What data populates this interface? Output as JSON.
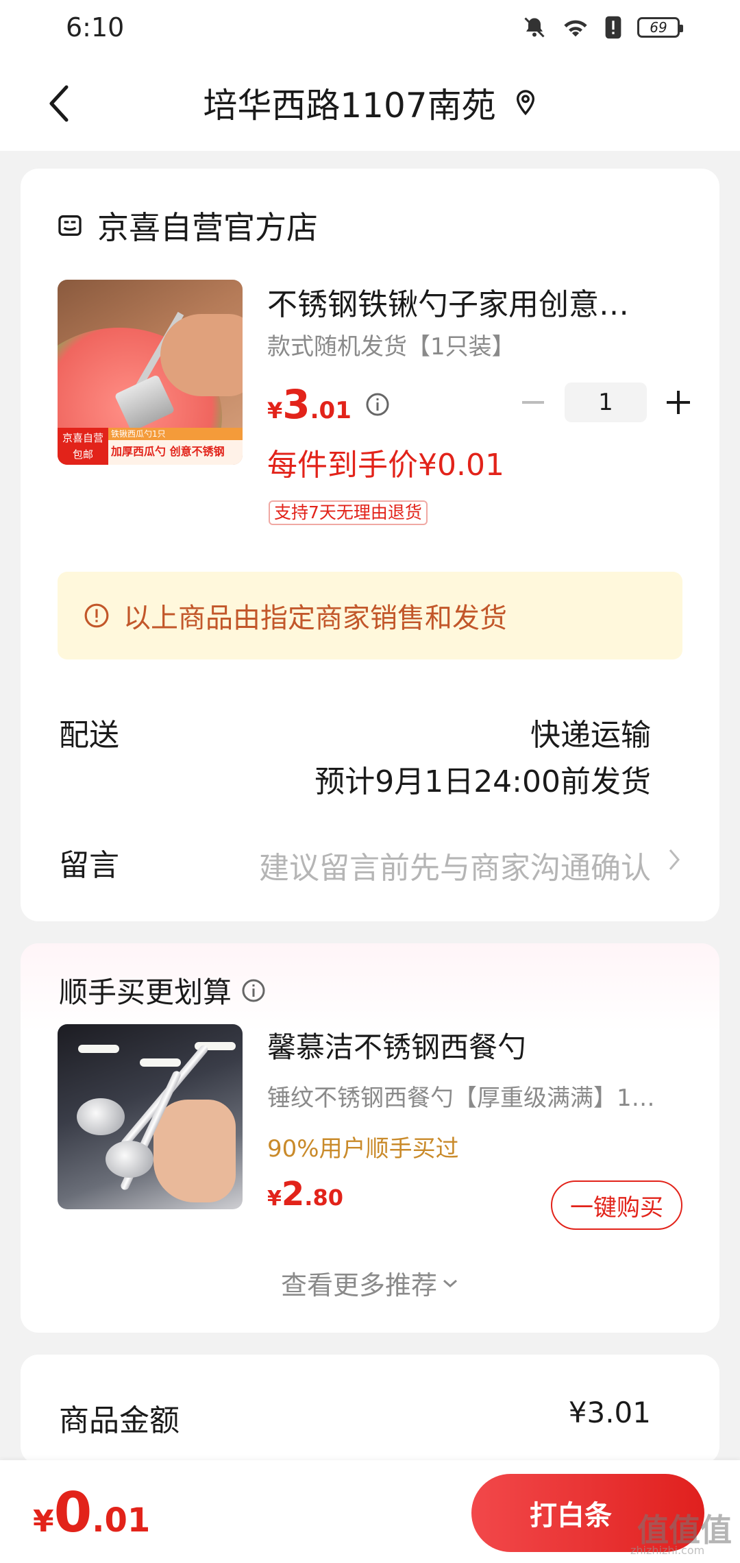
{
  "status_bar": {
    "time": "6:10",
    "battery": "69"
  },
  "header": {
    "title": "培华西路1107南苑"
  },
  "store": {
    "name": "京喜自营官方店"
  },
  "product": {
    "title": "不锈钢铁锹勺子家用创意…",
    "spec": "款式随机发货【1只装】",
    "price_symbol": "¥",
    "price_int": "3",
    "price_dec": ".01",
    "quantity": "1",
    "final_price": "每件到手价¥0.01",
    "return_badge": "支持7天无理由退货",
    "thumb_tag_left": "京喜自营\n包邮",
    "thumb_tag_top": "铁锹西瓜勺1只",
    "thumb_tag_bottom": "加厚西瓜勺 创意不锈钢"
  },
  "notice": {
    "text": "以上商品由指定商家销售和发货"
  },
  "delivery": {
    "label": "配送",
    "method": "快递运输",
    "eta": "预计9月1日24:00前发货"
  },
  "note": {
    "label": "留言",
    "placeholder": "建议留言前先与商家沟通确认"
  },
  "recommend": {
    "title": "顺手买更划算",
    "name": "馨慕洁不锈钢西餐勺",
    "spec": "锤纹不锈钢西餐勺【厚重级满满】1…",
    "social": "90%用户顺手买过",
    "price_symbol": "¥",
    "price_int": "2",
    "price_dec": ".80",
    "buy_label": "一键购买",
    "more_label": "查看更多推荐"
  },
  "summary": {
    "label": "商品金额",
    "value": "¥3.01"
  },
  "bottom": {
    "price_symbol": "¥",
    "price_int": "0",
    "price_dec": ".01",
    "pay_label": "打白条"
  },
  "watermark": {
    "main": "值值值",
    "sub": "zhizhizhi.com"
  },
  "colors": {
    "accent": "#e2231a",
    "notice_bg": "#fff8dc",
    "notice_text": "#c2572a"
  }
}
